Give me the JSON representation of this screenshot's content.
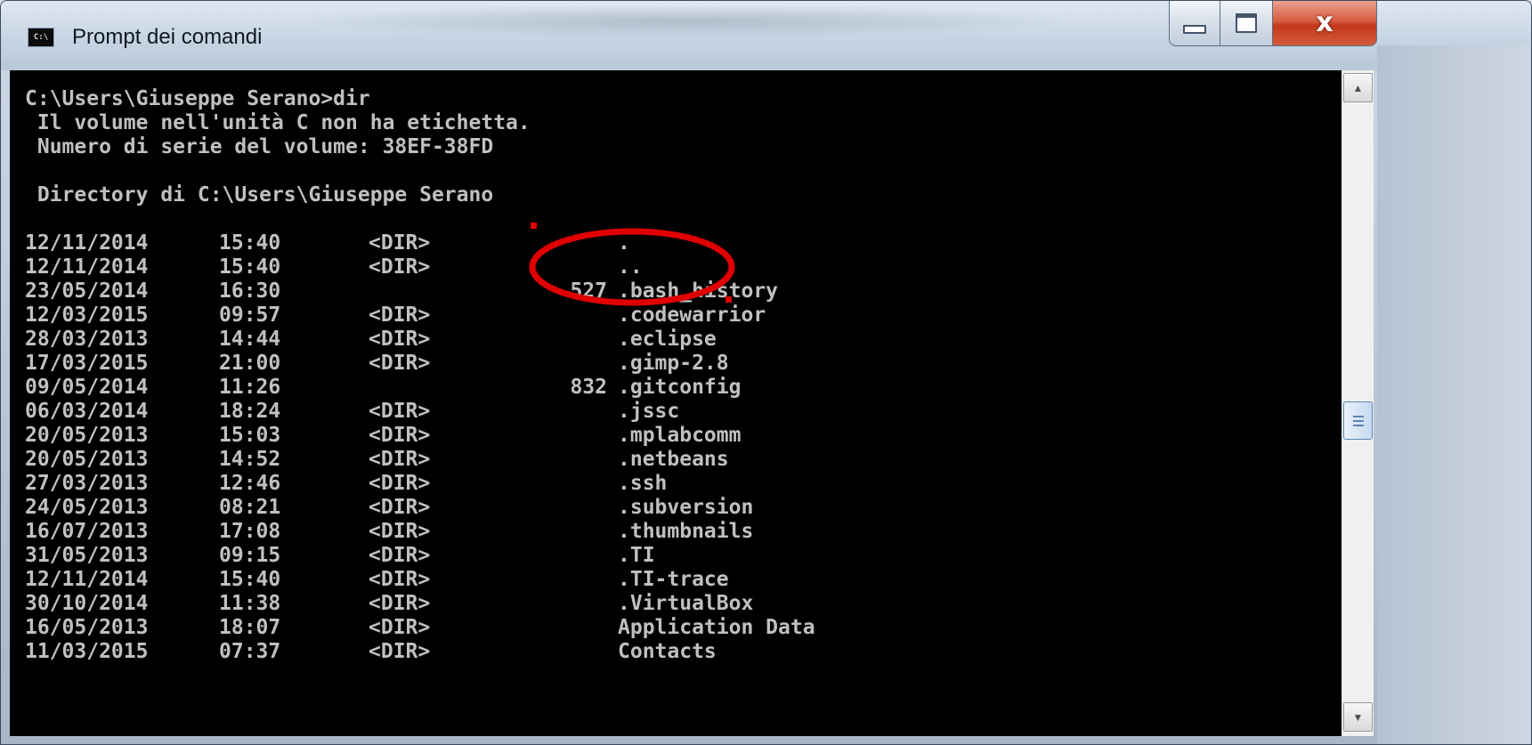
{
  "window": {
    "title": "Prompt dei comandi",
    "icon_label": "C:\\",
    "controls": {
      "minimize": "minimize-icon",
      "maximize": "maximize-icon",
      "close_glyph": "x"
    }
  },
  "console": {
    "header_lines": [
      "C:\\Users\\Giuseppe Serano>dir",
      " Il volume nell'unità C non ha etichetta.",
      " Numero di serie del volume: 38EF-38FD",
      "",
      " Directory di C:\\Users\\Giuseppe Serano",
      ""
    ],
    "entries": [
      {
        "date": "12/11/2014",
        "time": "15:40",
        "dir": "<DIR>",
        "size": "",
        "name": "."
      },
      {
        "date": "12/11/2014",
        "time": "15:40",
        "dir": "<DIR>",
        "size": "",
        "name": ".."
      },
      {
        "date": "23/05/2014",
        "time": "16:30",
        "dir": "",
        "size": "527",
        "name": ".bash_history"
      },
      {
        "date": "12/03/2015",
        "time": "09:57",
        "dir": "<DIR>",
        "size": "",
        "name": ".codewarrior"
      },
      {
        "date": "28/03/2013",
        "time": "14:44",
        "dir": "<DIR>",
        "size": "",
        "name": ".eclipse"
      },
      {
        "date": "17/03/2015",
        "time": "21:00",
        "dir": "<DIR>",
        "size": "",
        "name": ".gimp-2.8"
      },
      {
        "date": "09/05/2014",
        "time": "11:26",
        "dir": "",
        "size": "832",
        "name": ".gitconfig"
      },
      {
        "date": "06/03/2014",
        "time": "18:24",
        "dir": "<DIR>",
        "size": "",
        "name": ".jssc"
      },
      {
        "date": "20/05/2013",
        "time": "15:03",
        "dir": "<DIR>",
        "size": "",
        "name": ".mplabcomm"
      },
      {
        "date": "20/05/2013",
        "time": "14:52",
        "dir": "<DIR>",
        "size": "",
        "name": ".netbeans"
      },
      {
        "date": "27/03/2013",
        "time": "12:46",
        "dir": "<DIR>",
        "size": "",
        "name": ".ssh"
      },
      {
        "date": "24/05/2013",
        "time": "08:21",
        "dir": "<DIR>",
        "size": "",
        "name": ".subversion"
      },
      {
        "date": "16/07/2013",
        "time": "17:08",
        "dir": "<DIR>",
        "size": "",
        "name": ".thumbnails"
      },
      {
        "date": "31/05/2013",
        "time": "09:15",
        "dir": "<DIR>",
        "size": "",
        "name": ".TI"
      },
      {
        "date": "12/11/2014",
        "time": "15:40",
        "dir": "<DIR>",
        "size": "",
        "name": ".TI-trace"
      },
      {
        "date": "30/10/2014",
        "time": "11:38",
        "dir": "<DIR>",
        "size": "",
        "name": ".VirtualBox"
      },
      {
        "date": "16/05/2013",
        "time": "18:07",
        "dir": "<DIR>",
        "size": "",
        "name": "Application Data"
      },
      {
        "date": "11/03/2015",
        "time": "07:37",
        "dir": "<DIR>",
        "size": "",
        "name": "Contacts"
      }
    ]
  },
  "scrollbar": {
    "up_icon": "scroll-up-arrow-icon",
    "down_icon": "scroll-down-arrow-icon",
    "position_fraction": 0.5
  },
  "annotation": {
    "color": "#e00000",
    "shape": "ellipse-highlight-icon"
  },
  "colors": {
    "console_bg": "#000000",
    "console_text": "#c0c0c0",
    "close_button": "#c2381c"
  }
}
